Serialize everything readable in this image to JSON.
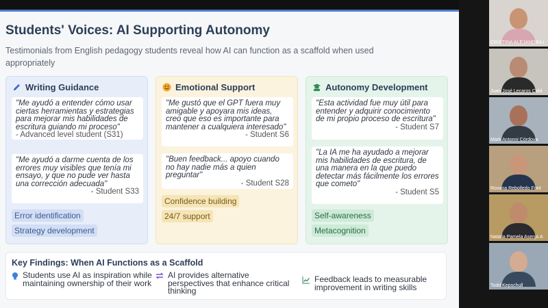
{
  "slide": {
    "title": "Students' Voices: AI Supporting Autonomy",
    "subtitle": "Testimonials from English pedagogy students reveal how AI can function as a scaffold when used appropriately",
    "accent_color": "#4c7bd0"
  },
  "cards": [
    {
      "title": "Writing Guidance",
      "icon": "pen-icon",
      "color": "#e7eefa",
      "quotes": [
        {
          "text": "\"Me ayudó a entender cómo usar ciertas herramientas y estrategias para mejorar mis habilidades de escritura guiando mi proceso\"",
          "author": "- Advanced level student (S31)"
        },
        {
          "text": "\"Me ayudó a darme cuenta de los errores muy visibles que tenía mi ensayo, y que no pude ver hasta una corrección adecuada\"",
          "author": "- Student S33"
        }
      ],
      "tags": [
        "Error identification",
        "Strategy development"
      ]
    },
    {
      "title": "Emotional Support",
      "icon": "smile-icon",
      "color": "#fbf3de",
      "quotes": [
        {
          "text": "\"Me gustó que el GPT fuera muy amigable y apoyara mis ideas, creo que eso es importante para mantener a cualquiera interesado\"",
          "author": "- Student S6"
        },
        {
          "text": "\"Buen feedback... apoyo cuando no hay nadie más a quien preguntar\"",
          "author": "- Student S28"
        }
      ],
      "tags": [
        "Confidence building",
        "24/7 support"
      ]
    },
    {
      "title": "Autonomy Development",
      "icon": "graduate-icon",
      "color": "#e4f4ea",
      "quotes": [
        {
          "text": "\"Esta actividad fue muy útil para entender y adquirir conocimiento de mi propio proceso de escritura\"",
          "author": "- Student S7"
        },
        {
          "text": "\"La IA me ha ayudado a mejorar mis habilidades de escritura, de una manera en la que puedo detectar más fácilmente los errores que cometo\"",
          "author": "- Student S5"
        }
      ],
      "tags": [
        "Self-awareness",
        "Metacognition"
      ]
    }
  ],
  "findings": {
    "title": "Key Findings: When AI Functions as a Scaffold",
    "items": [
      {
        "icon": "lightbulb-icon",
        "text": "Students use AI as inspiration while maintaining ownership of their work"
      },
      {
        "icon": "swap-arrows-icon",
        "text": "AI provides alternative perspectives that enhance critical thinking"
      },
      {
        "icon": "trend-chart-icon",
        "text": "Feedback leads to measurable improvement in writing skills"
      }
    ]
  },
  "participants": [
    {
      "name": "CRISTINA ALEJANDRA I"
    },
    {
      "name": "Juan José Lecaros Cald"
    },
    {
      "name": "Mark Antonni Córdova"
    },
    {
      "name": "Roxana Rebolledo Font"
    },
    {
      "name": "Natalia Pamela Asenjo A"
    },
    {
      "name": "Todd Kepschull"
    }
  ]
}
